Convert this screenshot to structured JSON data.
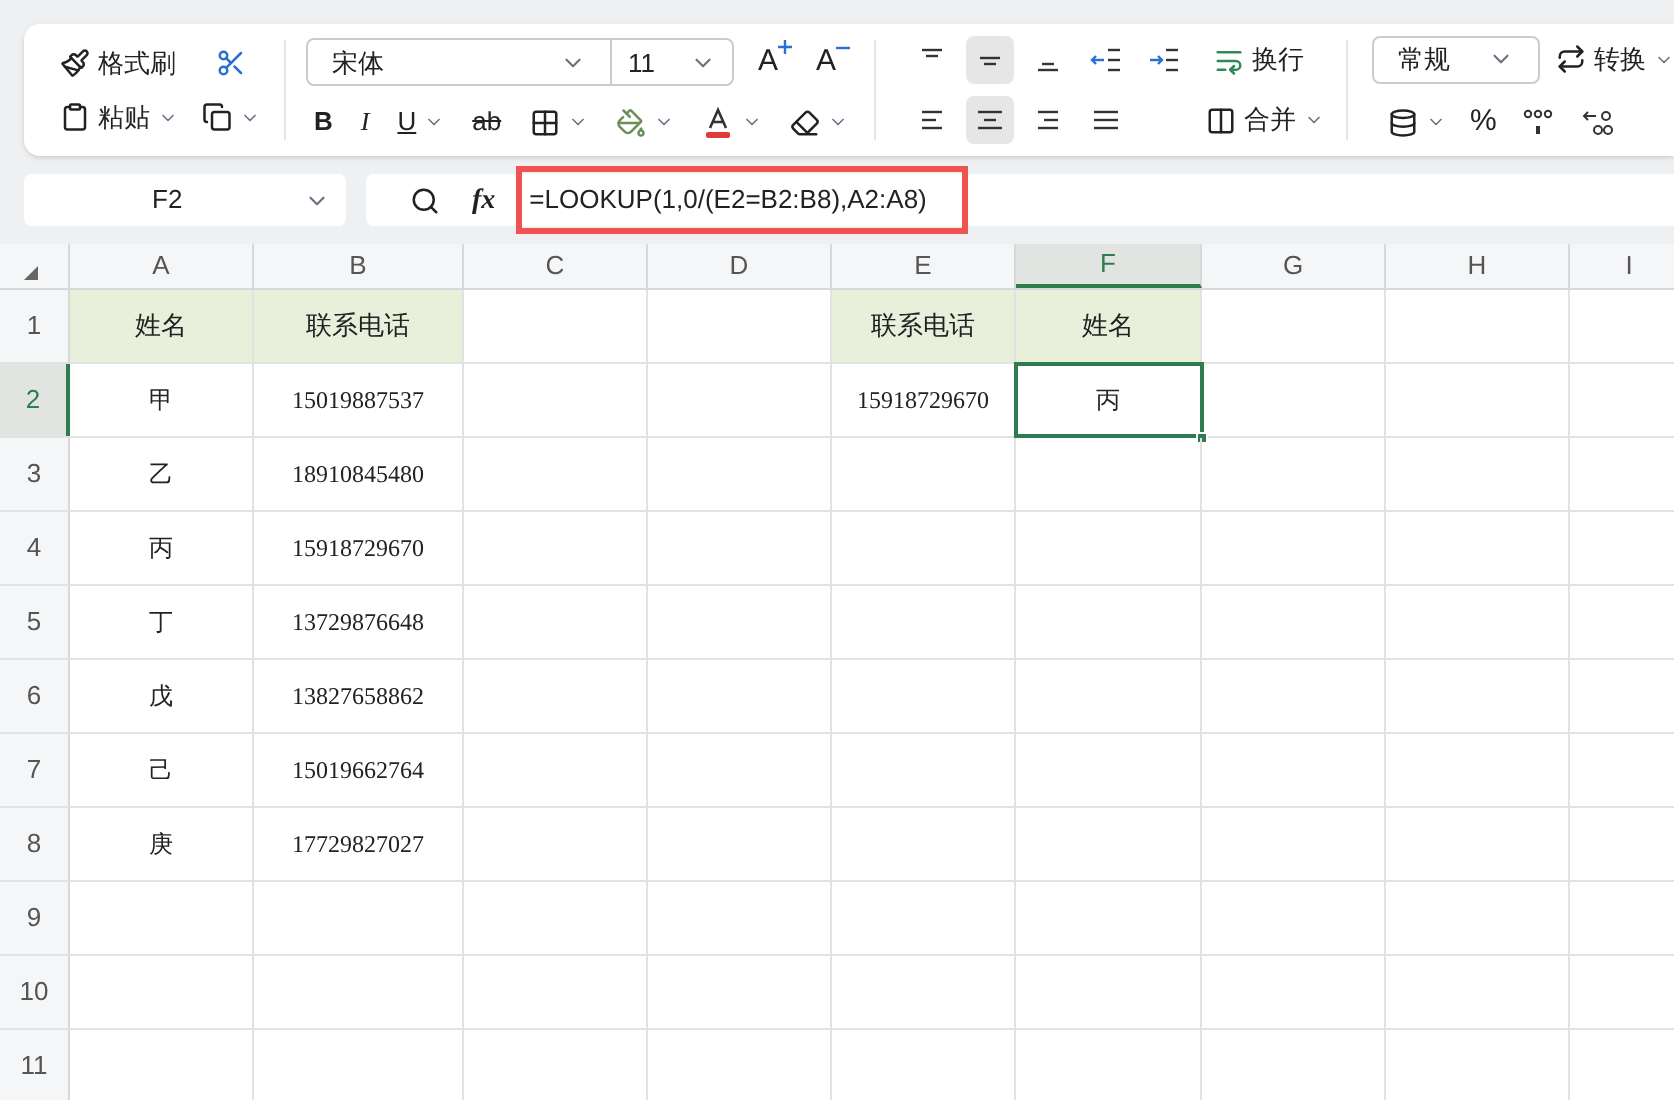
{
  "toolbar": {
    "format_painter": "格式刷",
    "paste": "粘贴",
    "font": "宋体",
    "font_size": "11",
    "grow_font": "A",
    "shrink_font": "A",
    "bold": "B",
    "italic": "I",
    "underline": "U",
    "strike": "ab",
    "vertical_align": [
      {
        "kind": "top",
        "selected": false
      },
      {
        "kind": "middle",
        "selected": true
      },
      {
        "kind": "bottom",
        "selected": false
      }
    ],
    "horizontal_align": [
      {
        "kind": "left",
        "selected": false
      },
      {
        "kind": "center",
        "selected": true
      },
      {
        "kind": "right",
        "selected": false
      },
      {
        "kind": "justify",
        "selected": false
      }
    ],
    "wrap": "换行",
    "merge": "合并",
    "number_format": "常规",
    "convert": "转换",
    "percent": "%"
  },
  "formula_bar": {
    "name_box": "F2",
    "fx": "fx",
    "formula": "=LOOKUP(1,0/(E2=B2:B8),A2:A8)",
    "highlighted": true
  },
  "columns": [
    {
      "label": "A",
      "selected": false
    },
    {
      "label": "B",
      "selected": false
    },
    {
      "label": "C",
      "selected": false
    },
    {
      "label": "D",
      "selected": false
    },
    {
      "label": "E",
      "selected": false
    },
    {
      "label": "F",
      "selected": true
    },
    {
      "label": "G",
      "selected": false
    },
    {
      "label": "H",
      "selected": false
    },
    {
      "label": "I",
      "selected": false
    }
  ],
  "rows": [
    {
      "label": "1",
      "selected": false,
      "cells": [
        {
          "kind": "header",
          "text": "姓名"
        },
        {
          "kind": "header",
          "text": "联系电话"
        },
        {
          "kind": "empty"
        },
        {
          "kind": "empty"
        },
        {
          "kind": "header",
          "text": "联系电话"
        },
        {
          "kind": "header",
          "text": "姓名"
        },
        {
          "kind": "empty"
        },
        {
          "kind": "empty"
        },
        {
          "kind": "empty"
        }
      ]
    },
    {
      "label": "2",
      "selected": true,
      "cells": [
        {
          "kind": "data",
          "text": "甲"
        },
        {
          "kind": "data",
          "text": "15019887537"
        },
        {
          "kind": "empty"
        },
        {
          "kind": "empty"
        },
        {
          "kind": "data",
          "text": "15918729670"
        },
        {
          "kind": "data",
          "text": "丙"
        },
        {
          "kind": "empty"
        },
        {
          "kind": "empty"
        },
        {
          "kind": "empty"
        }
      ]
    },
    {
      "label": "3",
      "selected": false,
      "cells": [
        {
          "kind": "data",
          "text": "乙"
        },
        {
          "kind": "data",
          "text": "18910845480"
        },
        {
          "kind": "empty"
        },
        {
          "kind": "empty"
        },
        {
          "kind": "empty"
        },
        {
          "kind": "empty"
        },
        {
          "kind": "empty"
        },
        {
          "kind": "empty"
        },
        {
          "kind": "empty"
        }
      ]
    },
    {
      "label": "4",
      "selected": false,
      "cells": [
        {
          "kind": "data",
          "text": "丙"
        },
        {
          "kind": "data",
          "text": "15918729670"
        },
        {
          "kind": "empty"
        },
        {
          "kind": "empty"
        },
        {
          "kind": "empty"
        },
        {
          "kind": "empty"
        },
        {
          "kind": "empty"
        },
        {
          "kind": "empty"
        },
        {
          "kind": "empty"
        }
      ]
    },
    {
      "label": "5",
      "selected": false,
      "cells": [
        {
          "kind": "data",
          "text": "丁"
        },
        {
          "kind": "data",
          "text": "13729876648"
        },
        {
          "kind": "empty"
        },
        {
          "kind": "empty"
        },
        {
          "kind": "empty"
        },
        {
          "kind": "empty"
        },
        {
          "kind": "empty"
        },
        {
          "kind": "empty"
        },
        {
          "kind": "empty"
        }
      ]
    },
    {
      "label": "6",
      "selected": false,
      "cells": [
        {
          "kind": "data",
          "text": "戊"
        },
        {
          "kind": "data",
          "text": "13827658862"
        },
        {
          "kind": "empty"
        },
        {
          "kind": "empty"
        },
        {
          "kind": "empty"
        },
        {
          "kind": "empty"
        },
        {
          "kind": "empty"
        },
        {
          "kind": "empty"
        },
        {
          "kind": "empty"
        }
      ]
    },
    {
      "label": "7",
      "selected": false,
      "cells": [
        {
          "kind": "data",
          "text": "己"
        },
        {
          "kind": "data",
          "text": "15019662764"
        },
        {
          "kind": "empty"
        },
        {
          "kind": "empty"
        },
        {
          "kind": "empty"
        },
        {
          "kind": "empty"
        },
        {
          "kind": "empty"
        },
        {
          "kind": "empty"
        },
        {
          "kind": "empty"
        }
      ]
    },
    {
      "label": "8",
      "selected": false,
      "cells": [
        {
          "kind": "data",
          "text": "庚"
        },
        {
          "kind": "data",
          "text": "17729827027"
        },
        {
          "kind": "empty"
        },
        {
          "kind": "empty"
        },
        {
          "kind": "empty"
        },
        {
          "kind": "empty"
        },
        {
          "kind": "empty"
        },
        {
          "kind": "empty"
        },
        {
          "kind": "empty"
        }
      ]
    },
    {
      "label": "9",
      "selected": false,
      "cells": [
        {
          "kind": "empty"
        },
        {
          "kind": "empty"
        },
        {
          "kind": "empty"
        },
        {
          "kind": "empty"
        },
        {
          "kind": "empty"
        },
        {
          "kind": "empty"
        },
        {
          "kind": "empty"
        },
        {
          "kind": "empty"
        },
        {
          "kind": "empty"
        }
      ]
    },
    {
      "label": "10",
      "selected": false,
      "cells": [
        {
          "kind": "empty"
        },
        {
          "kind": "empty"
        },
        {
          "kind": "empty"
        },
        {
          "kind": "empty"
        },
        {
          "kind": "empty"
        },
        {
          "kind": "empty"
        },
        {
          "kind": "empty"
        },
        {
          "kind": "empty"
        },
        {
          "kind": "empty"
        }
      ]
    },
    {
      "label": "11",
      "selected": false,
      "cells": [
        {
          "kind": "empty"
        },
        {
          "kind": "empty"
        },
        {
          "kind": "empty"
        },
        {
          "kind": "empty"
        },
        {
          "kind": "empty"
        },
        {
          "kind": "empty"
        },
        {
          "kind": "empty"
        },
        {
          "kind": "empty"
        },
        {
          "kind": "empty"
        }
      ]
    }
  ]
}
